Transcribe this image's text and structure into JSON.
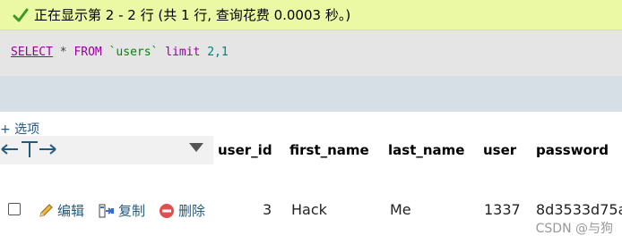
{
  "status": {
    "message": "正在显示第 2 - 2 行 (共 1 行, 查询花费 0.0003 秒。)",
    "icon": "check-icon",
    "color": "#ebf8a4"
  },
  "sql": {
    "select": "SELECT",
    "star": " * ",
    "from": "FROM",
    "space": " ",
    "table": "`users`",
    "limit": " limit ",
    "args": "2,1"
  },
  "options_link": "+ 选项",
  "table": {
    "columns": [
      "user_id",
      "first_name",
      "last_name",
      "user",
      "password"
    ],
    "rows": [
      {
        "actions": {
          "edit": "编辑",
          "copy": "复制",
          "delete": "删除"
        },
        "cells": [
          "3",
          "Hack",
          "Me",
          "1337",
          "8d3533d75a"
        ]
      }
    ]
  },
  "watermark": "CSDN @与狗"
}
